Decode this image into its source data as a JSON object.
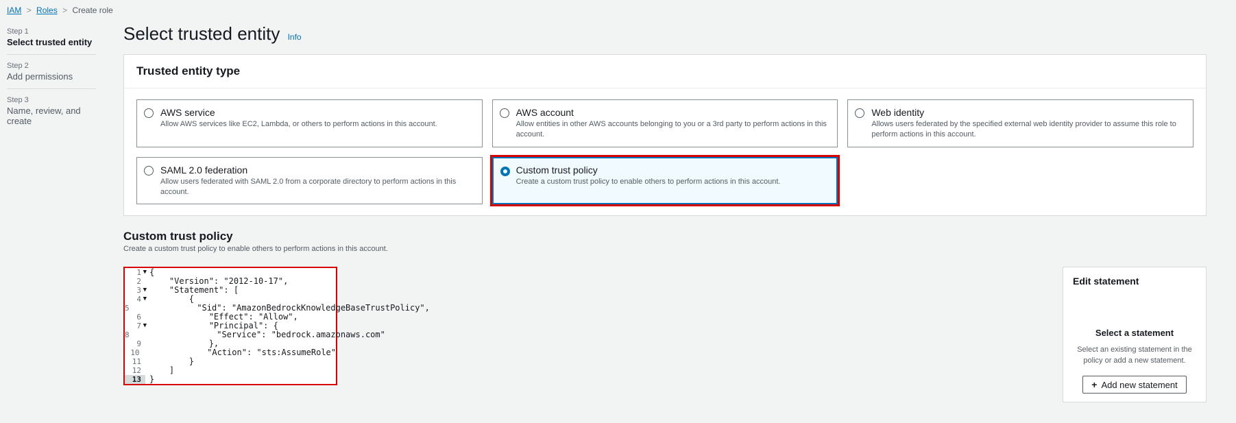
{
  "breadcrumb": {
    "iam": "IAM",
    "roles": "Roles",
    "current": "Create role"
  },
  "steps": [
    {
      "num": "Step 1",
      "label": "Select trusted entity"
    },
    {
      "num": "Step 2",
      "label": "Add permissions"
    },
    {
      "num": "Step 3",
      "label": "Name, review, and create"
    }
  ],
  "page": {
    "title": "Select trusted entity",
    "info": "Info"
  },
  "entity_panel": {
    "title": "Trusted entity type"
  },
  "cards": {
    "aws_service": {
      "title": "AWS service",
      "desc": "Allow AWS services like EC2, Lambda, or others to perform actions in this account."
    },
    "aws_account": {
      "title": "AWS account",
      "desc": "Allow entities in other AWS accounts belonging to you or a 3rd party to perform actions in this account."
    },
    "web_identity": {
      "title": "Web identity",
      "desc": "Allows users federated by the specified external web identity provider to assume this role to perform actions in this account."
    },
    "saml": {
      "title": "SAML 2.0 federation",
      "desc": "Allow users federated with SAML 2.0 from a corporate directory to perform actions in this account."
    },
    "custom": {
      "title": "Custom trust policy",
      "desc": "Create a custom trust policy to enable others to perform actions in this account."
    }
  },
  "policy_section": {
    "title": "Custom trust policy",
    "desc": "Create a custom trust policy to enable others to perform actions in this account."
  },
  "code_lines": {
    "l1": "{",
    "l2": "    \"Version\": \"2012-10-17\",",
    "l3": "    \"Statement\": [",
    "l4": "        {",
    "l5": "            \"Sid\": \"AmazonBedrockKnowledgeBaseTrustPolicy\",",
    "l6": "            \"Effect\": \"Allow\",",
    "l7": "            \"Principal\": {",
    "l8": "                \"Service\": \"bedrock.amazonaws.com\"",
    "l9": "            },",
    "l10": "            \"Action\": \"sts:AssumeRole\"",
    "l11": "        }",
    "l12": "    ]",
    "l13": "}"
  },
  "stmt_panel": {
    "title": "Edit statement",
    "select": "Select a statement",
    "desc": "Select an existing statement in the policy or add a new statement.",
    "btn": "Add new statement"
  }
}
